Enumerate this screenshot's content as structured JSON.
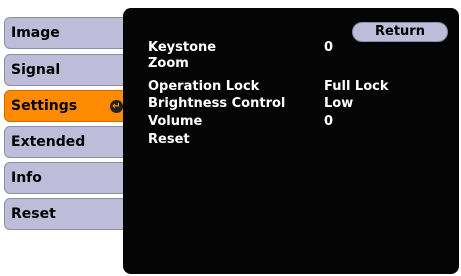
{
  "tabs": [
    {
      "label": "Image"
    },
    {
      "label": "Signal"
    },
    {
      "label": "Settings"
    },
    {
      "label": "Extended"
    },
    {
      "label": "Info"
    },
    {
      "label": "Reset"
    }
  ],
  "active_tab_icon": "enter-icon",
  "return_label": "Return",
  "settings": [
    {
      "label": "Keystone",
      "value": "0"
    },
    {
      "label": "Zoom",
      "value": ""
    },
    {
      "label": "Operation Lock",
      "value": "Full Lock"
    },
    {
      "label": "Brightness Control",
      "value": "Low"
    },
    {
      "label": "Volume",
      "value": "0"
    },
    {
      "label": "Reset",
      "value": ""
    }
  ],
  "colors": {
    "active_tab": "#ff8b00",
    "tab": "#bdbcd9",
    "panel": "#050505"
  }
}
